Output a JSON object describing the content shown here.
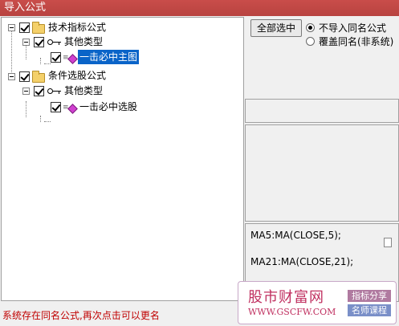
{
  "window": {
    "title": "导入公式"
  },
  "tree": {
    "nodes": [
      {
        "label": "技术指标公式",
        "checked": true,
        "icon": "folder-icon"
      },
      {
        "label": "其他类型",
        "checked": true,
        "icon": "key-icon"
      },
      {
        "label": "一击必中主图",
        "checked": true,
        "icon": "gem-icon",
        "selected": true
      },
      {
        "label": "条件选股公式",
        "checked": true,
        "icon": "folder-icon"
      },
      {
        "label": "其他类型",
        "checked": true,
        "icon": "key-icon"
      },
      {
        "label": "一击必中选股",
        "checked": true,
        "icon": "gem-icon"
      }
    ]
  },
  "controls": {
    "select_all_label": "全部选中",
    "radio_no_import": "不导入同名公式",
    "radio_overwrite": "覆盖同名(非系统)",
    "selected_radio": "no_import"
  },
  "code": {
    "lines": [
      "MA5:MA(CLOSE,5);",
      "MA21:MA(CLOSE,21);"
    ]
  },
  "status": {
    "message": "系统存在同名公式,再次点击可以更名"
  },
  "watermark": {
    "title": "股市财富网",
    "url": "WWW.GSCFW.COM",
    "tag1": "指标分享",
    "tag2": "名师课程"
  },
  "colors": {
    "titlebar": "#c0504d",
    "selection": "#0a64c8",
    "status_text": "#c00000"
  }
}
